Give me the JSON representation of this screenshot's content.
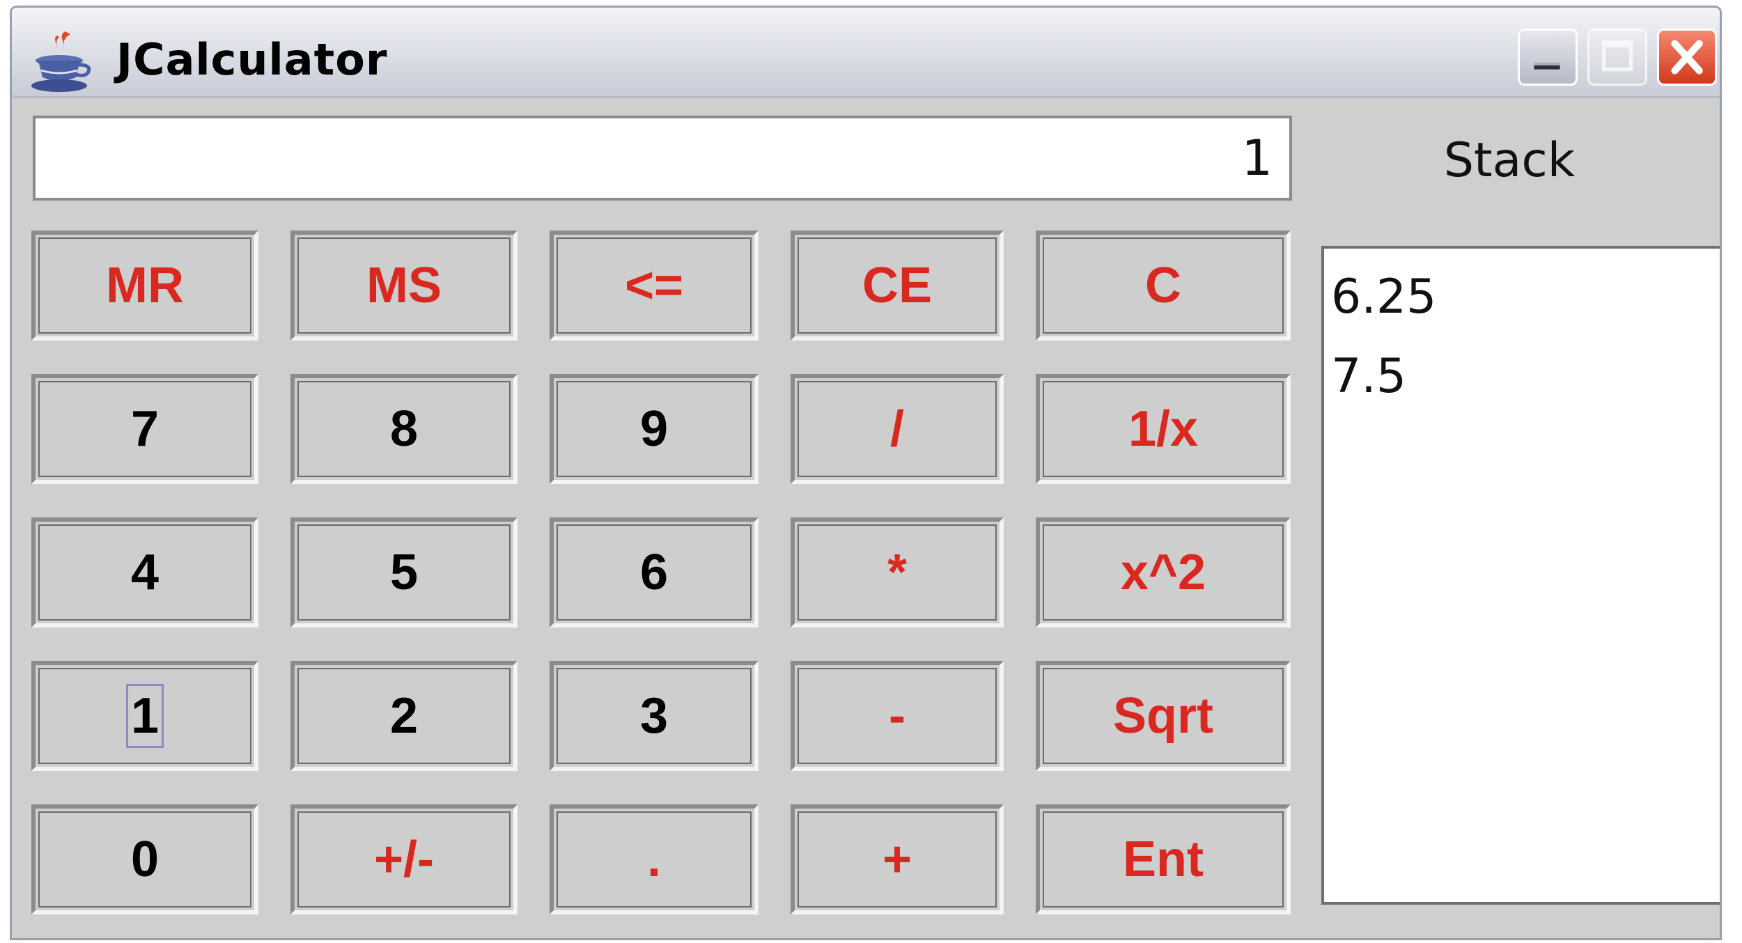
{
  "window": {
    "title": "JCalculator"
  },
  "display": {
    "value": "1"
  },
  "stack": {
    "label": "Stack",
    "items": [
      "6.25",
      "7.5"
    ]
  },
  "keys": [
    {
      "label": "MR",
      "color": "#d9281f"
    },
    {
      "label": "MS",
      "color": "#d9281f"
    },
    {
      "label": "<=",
      "color": "#d9281f"
    },
    {
      "label": "CE",
      "color": "#d9281f"
    },
    {
      "label": "C",
      "color": "#d9281f"
    },
    {
      "label": "7",
      "color": "#000000"
    },
    {
      "label": "8",
      "color": "#000000"
    },
    {
      "label": "9",
      "color": "#000000"
    },
    {
      "label": "/",
      "color": "#d9281f"
    },
    {
      "label": "1/x",
      "color": "#d9281f"
    },
    {
      "label": "4",
      "color": "#000000"
    },
    {
      "label": "5",
      "color": "#000000"
    },
    {
      "label": "6",
      "color": "#000000"
    },
    {
      "label": "*",
      "color": "#d9281f"
    },
    {
      "label": "x^2",
      "color": "#d9281f"
    },
    {
      "label": "1",
      "color": "#000000",
      "focused": true
    },
    {
      "label": "2",
      "color": "#000000"
    },
    {
      "label": "3",
      "color": "#000000"
    },
    {
      "label": "-",
      "color": "#d9281f"
    },
    {
      "label": "Sqrt",
      "color": "#d9281f"
    },
    {
      "label": "0",
      "color": "#000000"
    },
    {
      "label": "+/-",
      "color": "#d9281f"
    },
    {
      "label": ".",
      "color": "#d9281f"
    },
    {
      "label": "+",
      "color": "#d9281f"
    },
    {
      "label": "Ent",
      "color": "#d9281f"
    }
  ],
  "icons": {
    "app": "java-cup-icon",
    "minimize": "minimize-icon",
    "maximize": "maximize-icon",
    "close": "close-icon"
  }
}
